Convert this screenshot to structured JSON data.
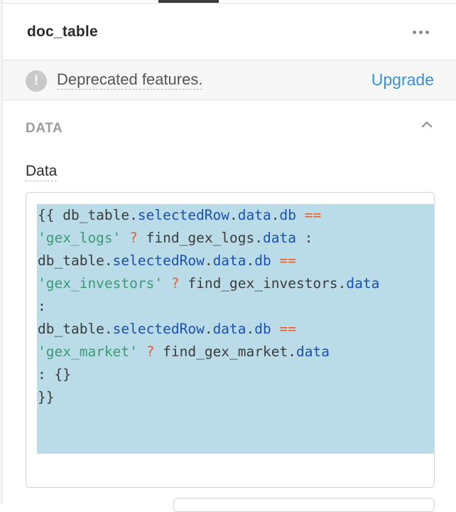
{
  "header": {
    "title": "doc_table",
    "more_icon": "more-horizontal-icon"
  },
  "banner": {
    "icon": "exclamation-icon",
    "icon_glyph": "!",
    "message": "Deprecated features.",
    "link_label": "Upgrade"
  },
  "section": {
    "title": "DATA",
    "expanded": true,
    "chevron_icon": "chevron-up-icon"
  },
  "field": {
    "label": "Data"
  },
  "editor": {
    "lines": [
      [
        {
          "t": "{{ db_table.",
          "c": ""
        },
        {
          "t": "selectedRow",
          "c": "p"
        },
        {
          "t": ".",
          "c": ""
        },
        {
          "t": "data",
          "c": "p"
        },
        {
          "t": ".",
          "c": ""
        },
        {
          "t": "db",
          "c": "p"
        },
        {
          "t": " ",
          "c": ""
        },
        {
          "t": "==",
          "c": "o"
        }
      ],
      [
        {
          "t": "'gex_logs'",
          "c": "s"
        },
        {
          "t": " ",
          "c": ""
        },
        {
          "t": "?",
          "c": "o"
        },
        {
          "t": " find_gex_logs.",
          "c": ""
        },
        {
          "t": "data",
          "c": "p"
        },
        {
          "t": " :",
          "c": ""
        }
      ],
      [
        {
          "t": "db_table.",
          "c": ""
        },
        {
          "t": "selectedRow",
          "c": "p"
        },
        {
          "t": ".",
          "c": ""
        },
        {
          "t": "data",
          "c": "p"
        },
        {
          "t": ".",
          "c": ""
        },
        {
          "t": "db",
          "c": "p"
        },
        {
          "t": " ",
          "c": ""
        },
        {
          "t": "==",
          "c": "o"
        }
      ],
      [
        {
          "t": "'gex_investors'",
          "c": "s"
        },
        {
          "t": " ",
          "c": ""
        },
        {
          "t": "?",
          "c": "o"
        },
        {
          "t": " find_gex_investors.",
          "c": ""
        },
        {
          "t": "data",
          "c": "p"
        }
      ],
      [
        {
          "t": ":",
          "c": ""
        }
      ],
      [
        {
          "t": "db_table.",
          "c": ""
        },
        {
          "t": "selectedRow",
          "c": "p"
        },
        {
          "t": ".",
          "c": ""
        },
        {
          "t": "data",
          "c": "p"
        },
        {
          "t": ".",
          "c": ""
        },
        {
          "t": "db",
          "c": "p"
        },
        {
          "t": " ",
          "c": ""
        },
        {
          "t": "==",
          "c": "o"
        }
      ],
      [
        {
          "t": "'gex_market'",
          "c": "s"
        },
        {
          "t": " ",
          "c": ""
        },
        {
          "t": "?",
          "c": "o"
        },
        {
          "t": " find_gex_market.",
          "c": ""
        },
        {
          "t": "data",
          "c": "p"
        }
      ],
      [
        {
          "t": ": {}",
          "c": ""
        }
      ],
      [
        {
          "t": "}}",
          "c": ""
        }
      ]
    ]
  },
  "colors": {
    "accent_link": "#3a8fd6",
    "selection": "#b9dce8",
    "property": "#1b4fb0",
    "string": "#3a9a74",
    "operator": "#e2622b"
  }
}
